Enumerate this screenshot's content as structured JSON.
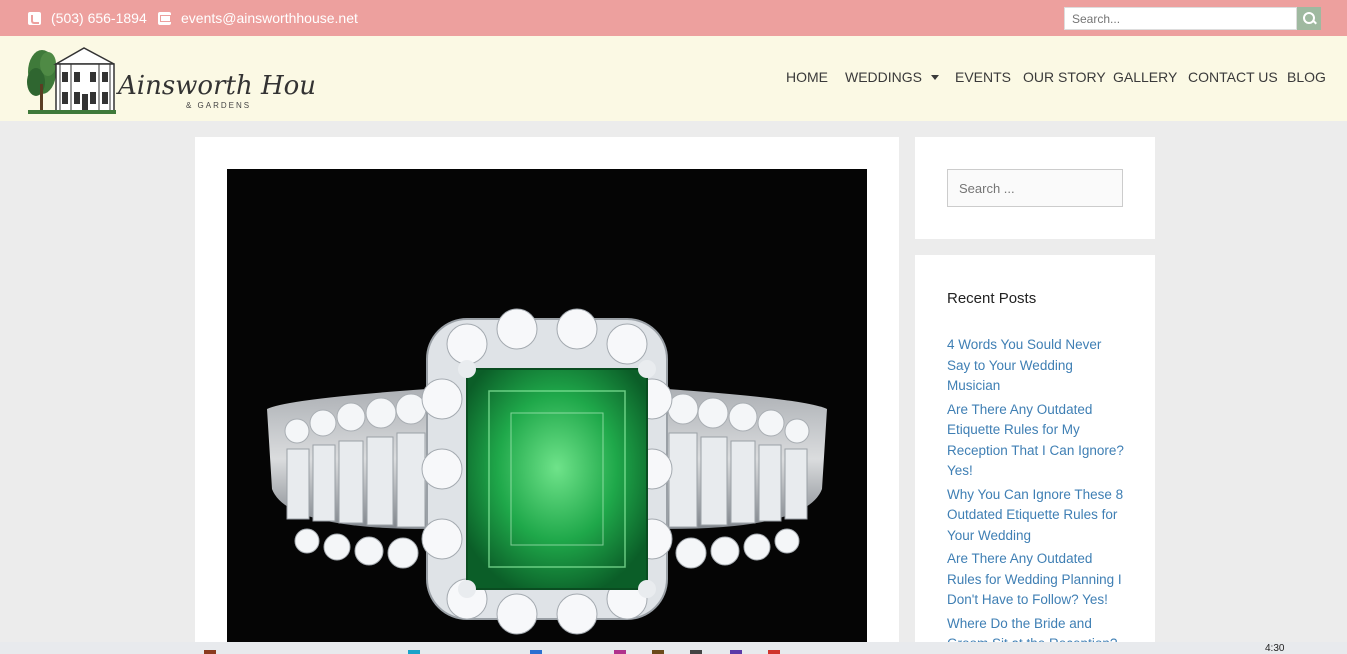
{
  "topbar": {
    "phone": "(503) 656-1894",
    "email": "events@ainsworthhouse.net",
    "search_placeholder": "Search..."
  },
  "header": {
    "logo_script": "Ainsworth House",
    "logo_sub": "& GARDENS",
    "nav": [
      {
        "label": "HOME"
      },
      {
        "label": "WEDDINGS"
      },
      {
        "label": "EVENTS"
      },
      {
        "label": "OUR STORY"
      },
      {
        "label": "GALLERY"
      },
      {
        "label": "CONTACT US"
      },
      {
        "label": "BLOG"
      }
    ]
  },
  "sidebar": {
    "search_placeholder": "Search ...",
    "recent_posts_title": "Recent Posts",
    "recent_posts": [
      "4 Words You Sould Never Say to Your Wedding Musician",
      "Are There Any Outdated Etiquette Rules for My Reception That I Can Ignore? Yes!",
      "Why You Can Ignore These 8 Outdated Etiquette Rules for Your Wedding",
      "Are There Any Outdated Rules for Wedding Planning I Don't Have to Follow? Yes!",
      "Where Do the Bride and Groom Sit at the Reception?"
    ]
  },
  "taskbar": {
    "time": "4:30"
  },
  "colors": {
    "topbar": "#eda09e",
    "header": "#fbf9e4",
    "link": "#3f7fb4",
    "search_button": "#9fb9a0"
  }
}
